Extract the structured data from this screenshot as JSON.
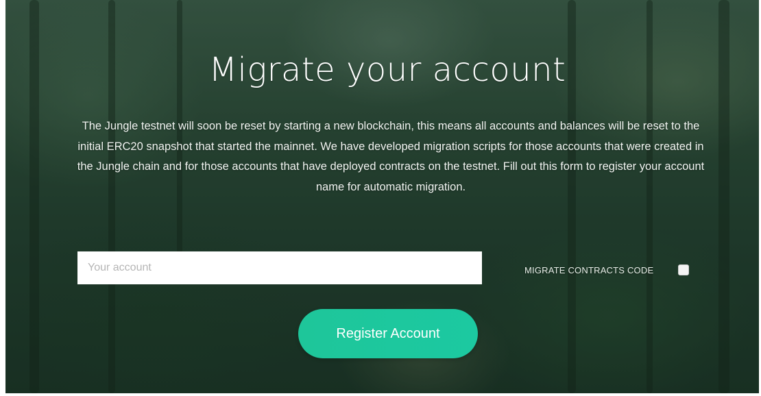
{
  "page": {
    "title": "Migrate your account",
    "description": "The Jungle testnet will soon be reset by starting a new blockchain, this means all accounts and balances will be reset to the initial ERC20 snapshot that started the mainnet. We have developed migration scripts for those accounts that were created in the Jungle chain and for those accounts that have deployed contracts on the testnet. Fill out this form to register your account name for automatic migration."
  },
  "form": {
    "account_placeholder": "Your account",
    "account_value": "",
    "migrate_contracts_label": "MIGRATE CONTRACTS CODE",
    "migrate_contracts_checked": false,
    "register_label": "Register Account"
  },
  "colors": {
    "accent": "#1ec69a",
    "background": "#2c4a38",
    "text": "#ffffff"
  }
}
